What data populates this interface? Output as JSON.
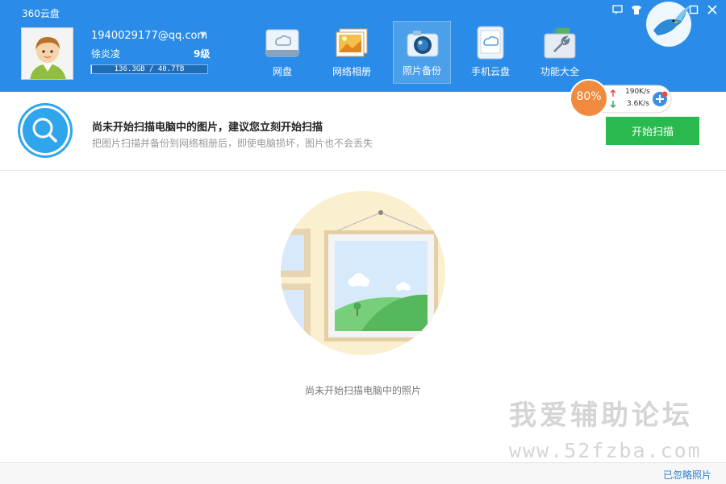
{
  "app": {
    "title": "360云盘"
  },
  "account": {
    "email": "1940029177@qq.com",
    "name": "徐炎凌",
    "level": "9级",
    "quota_text": "136.3GB / 40.7TB",
    "quota_fraction": 0.0033
  },
  "nav": {
    "tabs": [
      {
        "label": "网盘"
      },
      {
        "label": "网络相册"
      },
      {
        "label": "照片备份",
        "active": true
      },
      {
        "label": "手机云盘"
      },
      {
        "label": "功能大全"
      }
    ]
  },
  "speed": {
    "percent": "80%",
    "up": "190K/s",
    "down": "3.6K/s"
  },
  "scan": {
    "title": "尚未开始扫描电脑中的图片，建议您立刻开始扫描",
    "subtitle": "把图片扫描并备份到网络相册后，即使电脑损坏，图片也不会丢失",
    "button": "开始扫描"
  },
  "empty": {
    "text": "尚未开始扫描电脑中的照片"
  },
  "watermark": {
    "line1": "我爱辅助论坛",
    "line2": "www.52fzba.com"
  },
  "footer": {
    "ignored": "已忽略照片"
  },
  "colors": {
    "header": "#2a8ce8",
    "accent_green": "#2ab94f",
    "speed_orange": "#f08a3e"
  }
}
